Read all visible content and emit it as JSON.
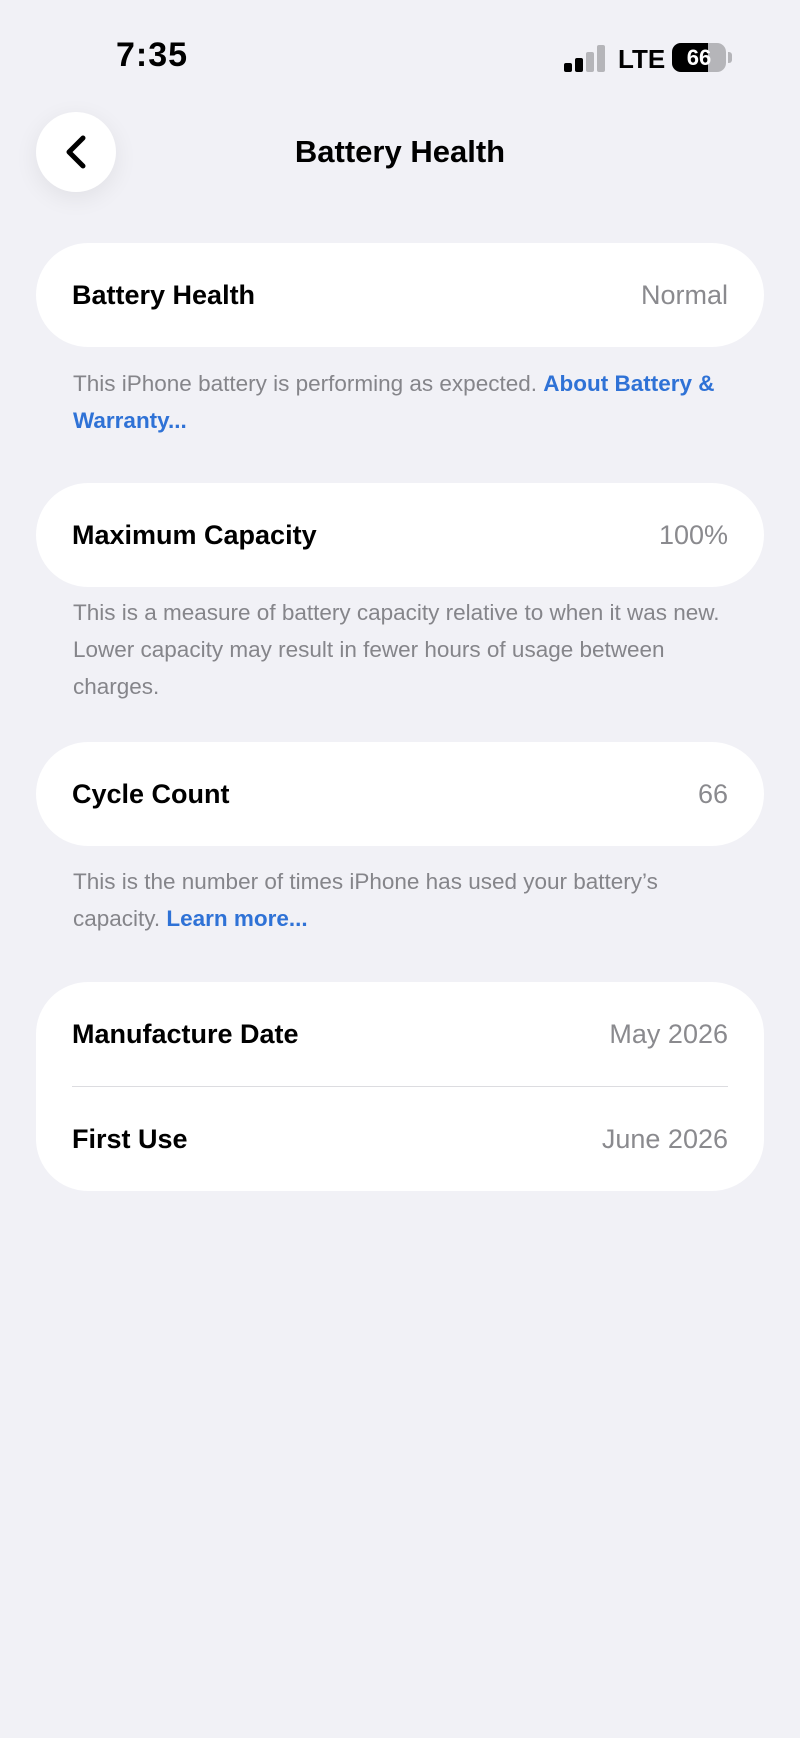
{
  "status_bar": {
    "time": "7:35",
    "network": "LTE",
    "battery_level": "66",
    "battery_fraction": 0.66,
    "signal_bars_active": 2,
    "signal_bars_total": 4
  },
  "nav": {
    "title": "Battery Health",
    "back_icon": "chevron-left-icon"
  },
  "sections": {
    "health": {
      "label": "Battery Health",
      "value": "Normal",
      "footnote_text": "This iPhone battery is performing as expected. ",
      "footnote_link": "About Battery & Warranty..."
    },
    "capacity": {
      "label": "Maximum Capacity",
      "value": "100%",
      "footnote_text": "This is a measure of battery capacity relative to when it was new. Lower capacity may result in fewer hours of usage between charges."
    },
    "cycles": {
      "label": "Cycle Count",
      "value": "66",
      "footnote_text": "This is the number of times iPhone has used your battery’s capacity. ",
      "footnote_link": "Learn more..."
    },
    "dates": {
      "manufacture_label": "Manufacture Date",
      "manufacture_value": "May 2026",
      "first_use_label": "First Use",
      "first_use_value": "June 2026"
    }
  },
  "colors": {
    "background": "#f1f1f6",
    "link": "#2f72d6",
    "secondary_text": "#8a8a8e"
  }
}
